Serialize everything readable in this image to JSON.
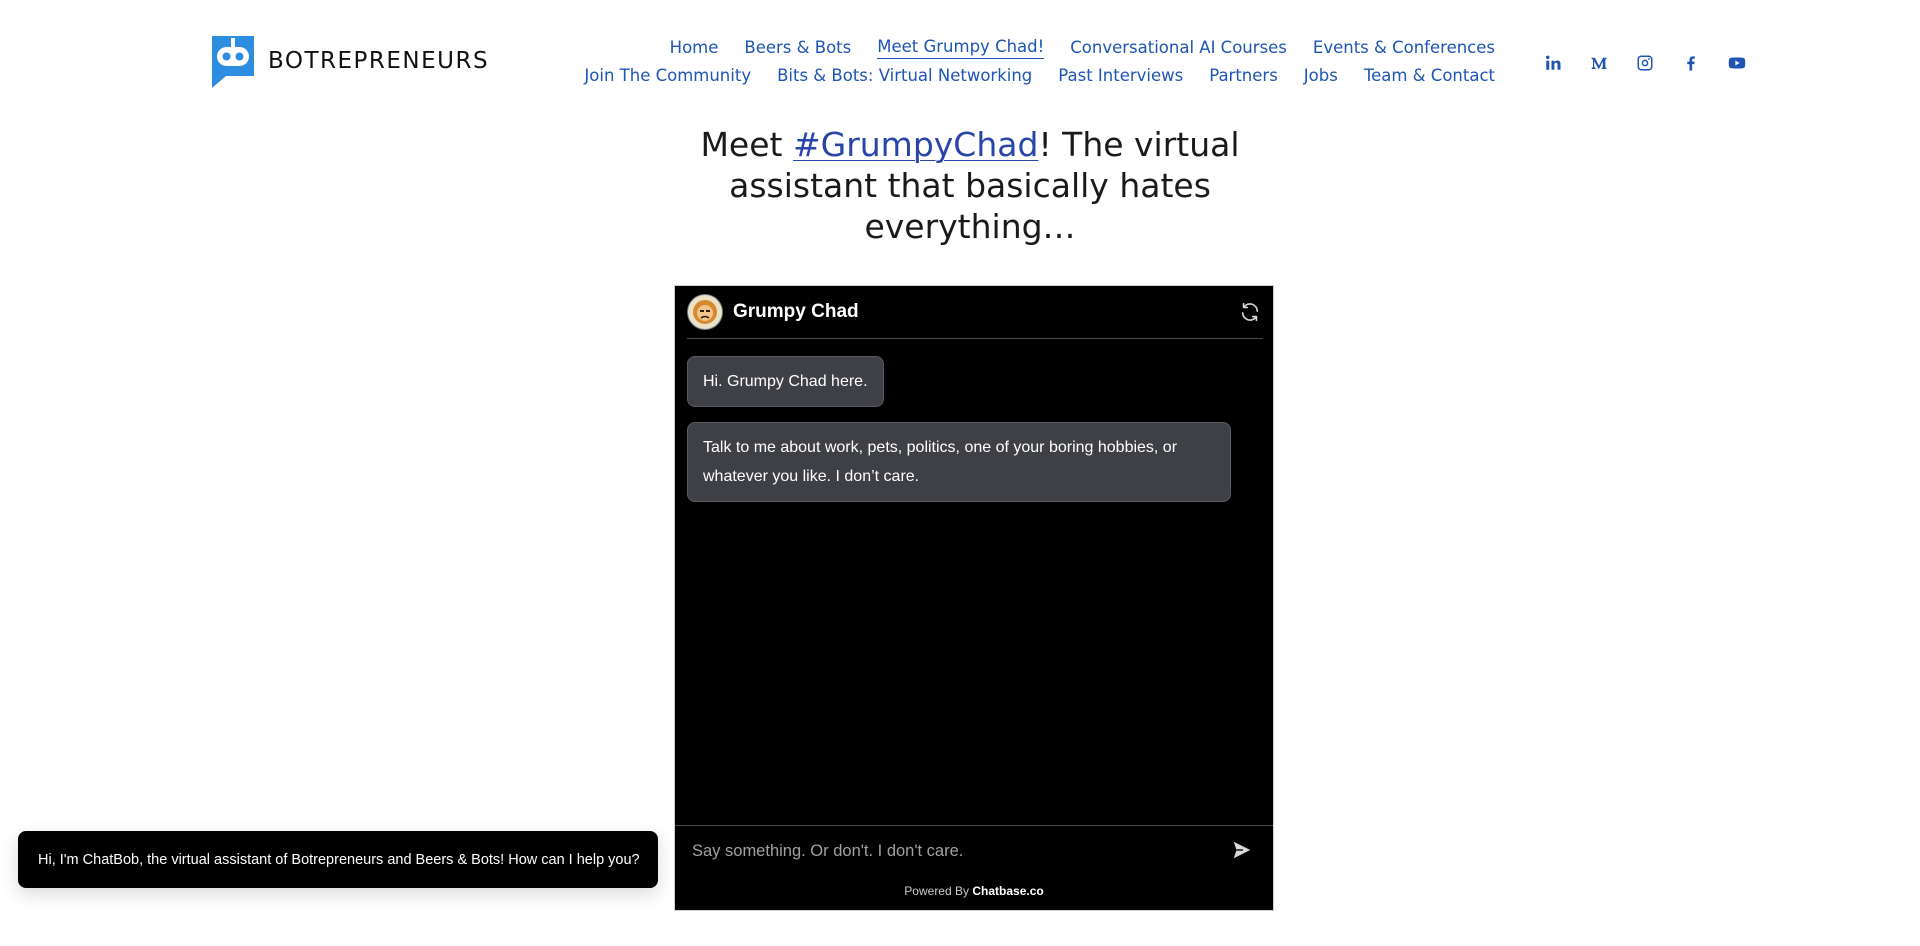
{
  "brand": {
    "name": "BOTREPRENEURS",
    "accent": "#2d8ee0"
  },
  "nav": {
    "row1": [
      "Home",
      "Beers & Bots",
      "Meet Grumpy Chad!",
      "Conversational AI Courses",
      "Events & Conferences"
    ],
    "row2": [
      "Join The Community",
      "Bits & Bots: Virtual Networking",
      "Past Interviews",
      "Partners",
      "Jobs",
      "Team & Contact"
    ],
    "active": "Meet Grumpy Chad!",
    "link_color": "#1e55b3"
  },
  "social": [
    "linkedin-icon",
    "medium-icon",
    "instagram-icon",
    "facebook-icon",
    "youtube-icon"
  ],
  "headline": {
    "prefix": "Meet ",
    "link": "#GrumpyChad",
    "suffix": "! The virtual assistant that basically hates everything…"
  },
  "chat": {
    "title": "Grumpy Chad",
    "messages": [
      "Hi. Grumpy Chad here.",
      "Talk to me about work, pets, politics, one of your boring hobbies, or whatever you like. I don’t care."
    ],
    "input_placeholder": "Say something. Or don't. I don't care.",
    "powered_prefix": "Powered By ",
    "powered_brand": "Chatbase.co"
  },
  "toast": {
    "text": "Hi, I'm ChatBob, the virtual assistant of Botrepreneurs and Beers & Bots! How can I help you?"
  }
}
